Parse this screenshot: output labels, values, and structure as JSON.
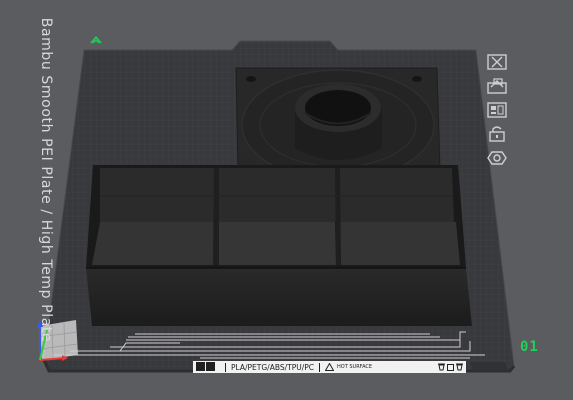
{
  "plate": {
    "name_label": "Bambu Smooth PEI Plate / High Temp Plate",
    "number": "01",
    "materials_label": "PLA/PETG/ABS/TPU/PC",
    "hot_surface_label": "HOT SURFACE"
  },
  "toolbar": {
    "buttons": [
      {
        "icon": "close-x-icon",
        "interactable": true
      },
      {
        "icon": "auto-orient-icon",
        "interactable": true
      },
      {
        "icon": "arrange-icon",
        "interactable": true
      },
      {
        "icon": "lock-icon",
        "interactable": true
      },
      {
        "icon": "plate-settings-icon",
        "interactable": true
      }
    ]
  },
  "colors": {
    "background": "#5b5c5f",
    "plate": "#38393c",
    "model": "#262626",
    "accent_green": "#1fd05a",
    "axis_x": "#e53a3a",
    "axis_y": "#3acb3a",
    "axis_z": "#3a5ae8"
  }
}
